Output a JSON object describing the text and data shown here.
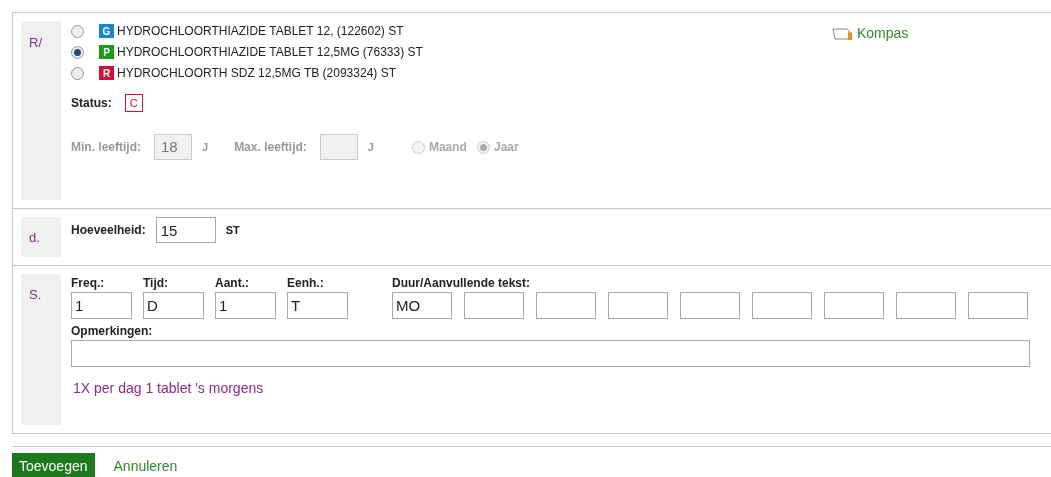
{
  "prescription": {
    "marker": "R/",
    "products": [
      {
        "badge": "G",
        "color": "#1a86d0",
        "name": "HYDROCHLOORTHIAZIDE TABLET 12, (122602) ST",
        "selected": false
      },
      {
        "badge": "P",
        "color": "#1a9a1a",
        "name": "HYDROCHLOORTHIAZIDE TABLET 12,5MG (76333) ST",
        "selected": true
      },
      {
        "badge": "R",
        "color": "#d0103a",
        "name": "HYDROCHLOORTH SDZ 12,5MG TB (2093324) ST",
        "selected": false
      }
    ],
    "link": "Kompas",
    "status_label": "Status:",
    "status_code": "C",
    "age": {
      "disabled": true,
      "min_label": "Min. leeftijd:",
      "min_value": "18",
      "min_unit": "J",
      "max_label": "Max. leeftijd:",
      "max_unit": "J",
      "periods": [
        {
          "label": "Maand",
          "selected": false
        },
        {
          "label": "Jaar",
          "selected": true
        }
      ]
    }
  },
  "quantity": {
    "marker": "d.",
    "label": "Hoeveelheid:",
    "value": "15",
    "unit": "ST"
  },
  "dosage": {
    "marker": "S.",
    "fields": [
      {
        "label": "Freq.:",
        "value": "1"
      },
      {
        "label": "Tijd:",
        "value": "D"
      },
      {
        "label": "Aant.:",
        "value": "1"
      },
      {
        "label": "Eenh.:",
        "value": "T"
      }
    ],
    "duration_label": "Duur/Aanvullende tekst:",
    "duration_values": [
      "MO"
    ],
    "remarks_label": "Opmerkingen:",
    "summary": "1X per dag 1 tablet 's morgens"
  },
  "buttons": {
    "primary": "Toevoegen",
    "secondary": "Annuleren"
  }
}
